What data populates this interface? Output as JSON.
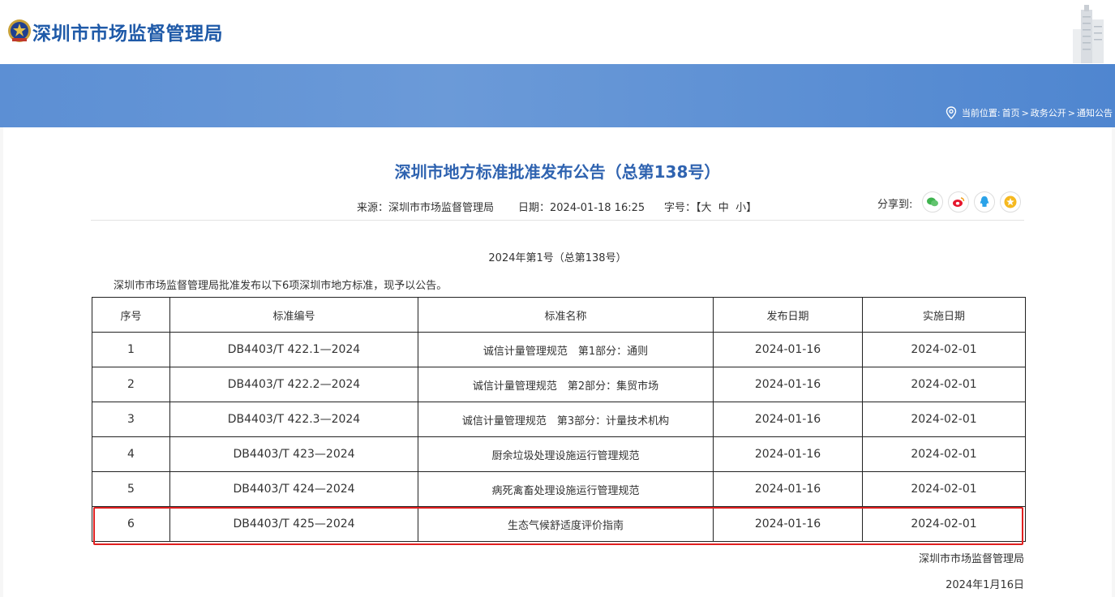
{
  "header": {
    "site_title": "深圳市市场监督管理局"
  },
  "breadcrumb": {
    "label": "当前位置:",
    "items": [
      "首页",
      "政务公开",
      "通知公告"
    ],
    "separator": ">"
  },
  "article": {
    "title": "深圳市地方标准批准发布公告（总第138号）",
    "source": "来源：深圳市市场监督管理局",
    "date": "日期：2024-01-18 16:25",
    "font_size_label": "字号：",
    "font_size_large": "【大",
    "font_size_medium": "中",
    "font_size_small": "小】",
    "share_label": "分享到:",
    "share_icons": [
      "wechat-icon",
      "weibo-icon",
      "qq-icon",
      "favorite-icon"
    ],
    "issue_line": "2024年第1号（总第138号）",
    "intro": "深圳市市场监督管理局批准发布以下6项深圳市地方标准，现予以公告。",
    "signature": "深圳市市场监督管理局",
    "sign_date": "2024年1月16日"
  },
  "table": {
    "headers": [
      "序号",
      "标准编号",
      "标准名称",
      "发布日期",
      "实施日期"
    ],
    "rows": [
      [
        "1",
        "DB4403/T 422.1—2024",
        "诚信计量管理规范　第1部分：通则",
        "2024-01-16",
        "2024-02-01"
      ],
      [
        "2",
        "DB4403/T 422.2—2024",
        "诚信计量管理规范　第2部分：集贸市场",
        "2024-01-16",
        "2024-02-01"
      ],
      [
        "3",
        "DB4403/T 422.3—2024",
        "诚信计量管理规范　第3部分：计量技术机构",
        "2024-01-16",
        "2024-02-01"
      ],
      [
        "4",
        "DB4403/T 423—2024",
        "厨余垃圾处理设施运行管理规范",
        "2024-01-16",
        "2024-02-01"
      ],
      [
        "5",
        "DB4403/T 424—2024",
        "病死禽畜处理设施运行管理规范",
        "2024-01-16",
        "2024-02-01"
      ],
      [
        "6",
        "DB4403/T 425—2024",
        "生态气候舒适度评价指南",
        "2024-01-16",
        "2024-02-01"
      ]
    ]
  },
  "colors": {
    "brand_blue": "#1f5aa8",
    "title_blue": "#2f63b0",
    "highlight_red": "#e02020",
    "banner": "#5c8fd4"
  }
}
